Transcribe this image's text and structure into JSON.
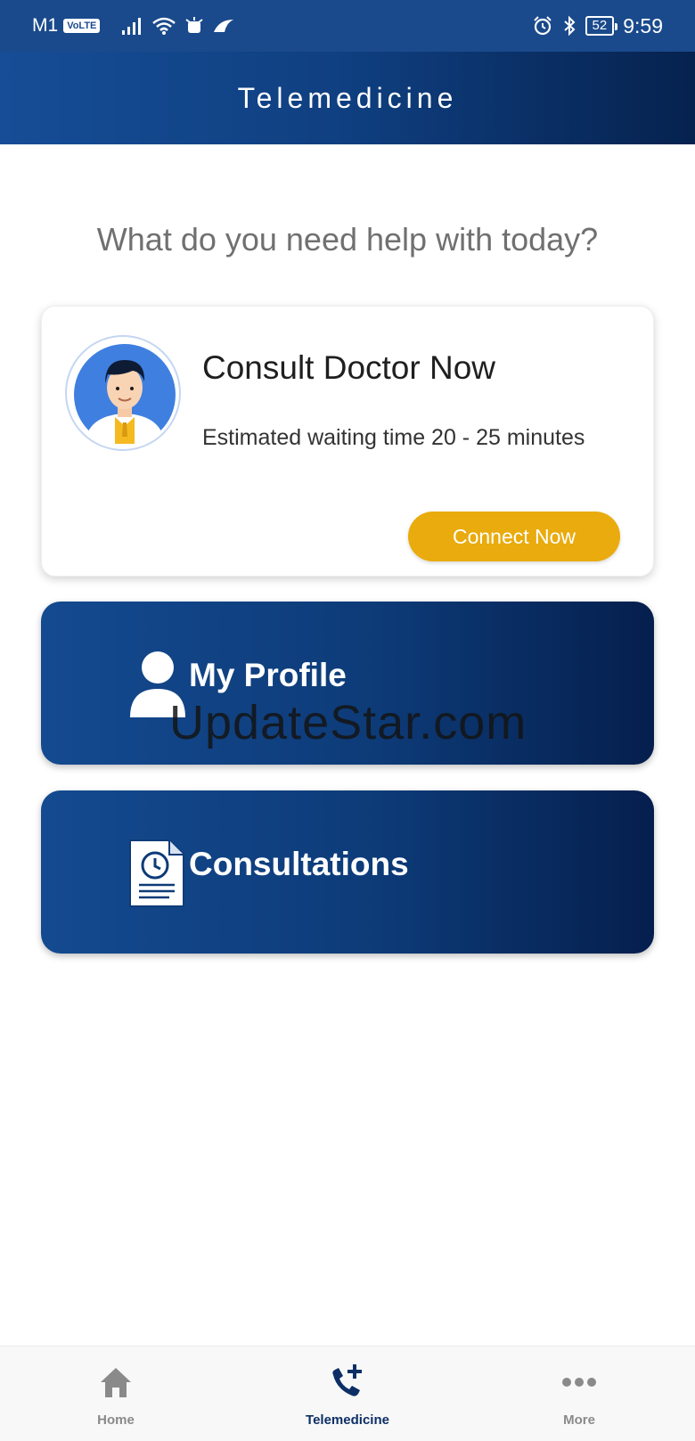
{
  "status_bar": {
    "carrier": "M1",
    "volte": "VoLTE",
    "battery": "52",
    "time": "9:59"
  },
  "header": {
    "title": "Telemedicine"
  },
  "question": "What do you need help with today?",
  "consult_card": {
    "title": "Consult Doctor Now",
    "wait_text": "Estimated waiting time 20 - 25 minutes",
    "button_label": "Connect Now"
  },
  "nav_cards": [
    {
      "label": "My Profile"
    },
    {
      "label": "Consultations"
    }
  ],
  "watermark": "UpdateStar.com",
  "bottom_nav": [
    {
      "label": "Home",
      "icon": "home-icon"
    },
    {
      "label": "Telemedicine",
      "icon": "phone-plus-icon",
      "active": true
    },
    {
      "label": "More",
      "icon": "more-dots-icon"
    }
  ],
  "colors": {
    "primary": "#0d3b78",
    "accent": "#e9ab0d",
    "active_nav": "#0d2f66"
  }
}
